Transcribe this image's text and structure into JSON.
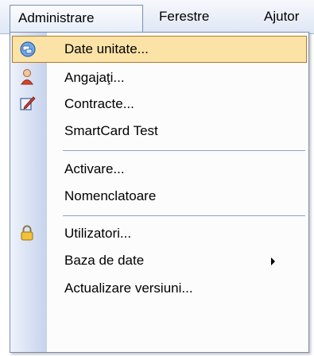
{
  "menubar": {
    "items": [
      {
        "label": "Administrare"
      },
      {
        "label": "Ferestre"
      },
      {
        "label": "Ajutor"
      }
    ]
  },
  "dropdown": {
    "items": [
      {
        "label": "Date unitate...",
        "icon": "database-icon"
      },
      {
        "label": "Angajaţi...",
        "icon": "user-icon"
      },
      {
        "label": "Contracte...",
        "icon": "edit-document-icon"
      },
      {
        "label": "SmartCard Test"
      },
      {
        "label": "Activare..."
      },
      {
        "label": "Nomenclatoare"
      },
      {
        "label": "Utilizatori...",
        "icon": "lock-icon"
      },
      {
        "label": "Baza de date",
        "submenu": true
      },
      {
        "label": "Actualizare versiuni..."
      }
    ]
  },
  "colors": {
    "highlight_fill": "#fbe3a8",
    "highlight_border": "#b47a2c",
    "gutter": "#c6d3ec"
  }
}
